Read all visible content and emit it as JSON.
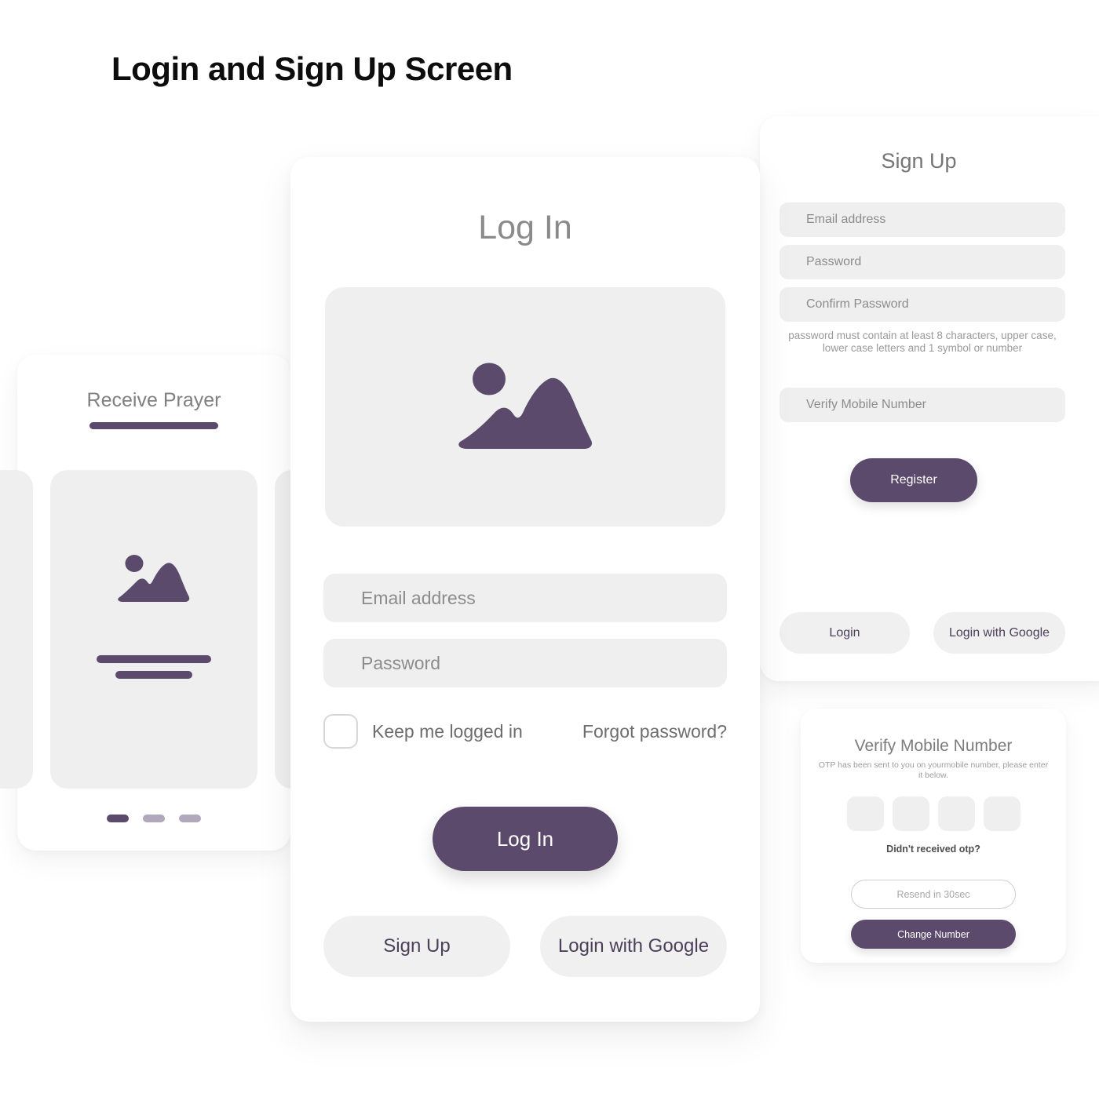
{
  "page": {
    "title": "Login and Sign Up Screen",
    "accent_color": "#5b4a6b",
    "field_bg_color": "#efefef",
    "card_bg_color": "#ffffff"
  },
  "onboarding_card": {
    "title": "Receive Prayer",
    "image_icon": "image-placeholder-icon",
    "placeholder_bars": 2,
    "pagination": {
      "total": 3,
      "active_index": 0
    }
  },
  "login_card": {
    "title": "Log In",
    "image_icon": "image-placeholder-icon",
    "fields": [
      {
        "name": "email",
        "placeholder": "Email address",
        "value": ""
      },
      {
        "name": "password",
        "placeholder": "Password",
        "value": ""
      }
    ],
    "keep_logged_in_label": "Keep me logged in",
    "keep_logged_in_checked": false,
    "forgot_password_label": "Forgot password?",
    "primary_button": "Log In",
    "secondary_buttons": [
      "Sign Up",
      "Login with Google"
    ]
  },
  "signup_card": {
    "title": "Sign Up",
    "fields": [
      {
        "name": "email",
        "placeholder": "Email address",
        "value": ""
      },
      {
        "name": "password",
        "placeholder": "Password",
        "value": ""
      },
      {
        "name": "confirm_password",
        "placeholder": "Confirm Password",
        "value": ""
      },
      {
        "name": "mobile",
        "placeholder": "Verify Mobile Number",
        "value": ""
      }
    ],
    "password_hint": "password must contain at least 8 characters, upper case, lower case letters and 1 symbol or number",
    "primary_button": "Register",
    "secondary_buttons": [
      "Login",
      "Login with Google"
    ]
  },
  "otp_card": {
    "title": "Verify Mobile Number",
    "subtitle": "OTP has been sent to you on yourmobile number, please enter it below.",
    "otp_inputs": [
      {
        "value": ""
      },
      {
        "value": ""
      },
      {
        "value": ""
      },
      {
        "value": ""
      }
    ],
    "resend_question": "Didn't received otp?",
    "resend_button": "Resend in 30sec",
    "change_number_button": "Change Number"
  }
}
